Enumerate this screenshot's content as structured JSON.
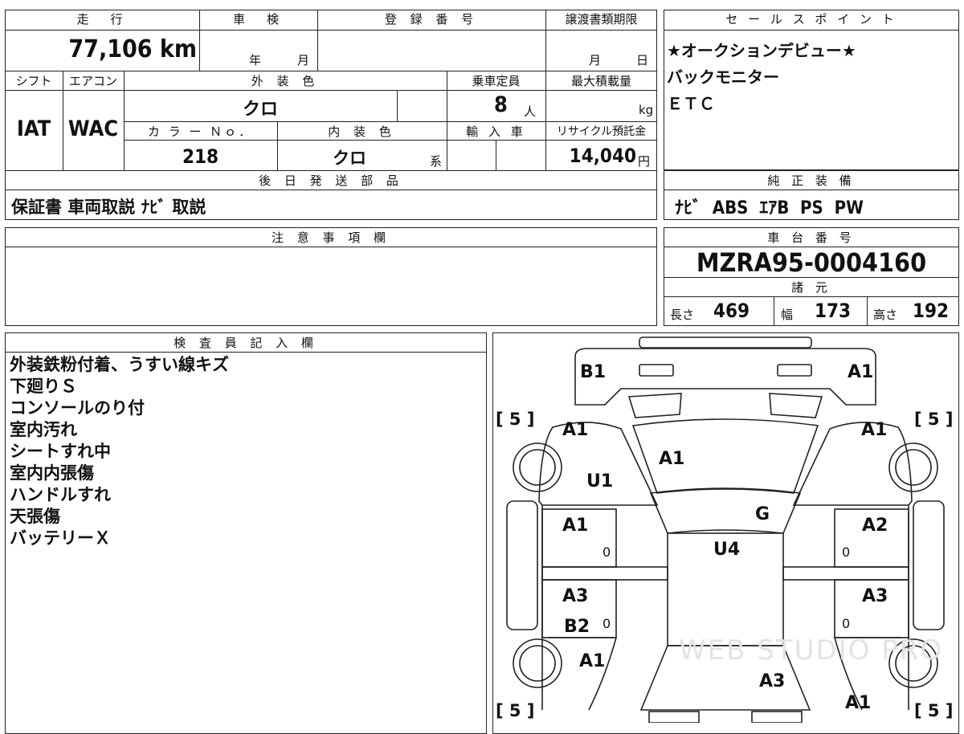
{
  "top_table": {
    "mileage_header": "走　行",
    "mileage_value": "77,106 km",
    "inspection_header": "車　検",
    "inspection_year_unit": "年",
    "inspection_month_unit": "月",
    "registration_header": "登 録 番 号",
    "transfer_deadline_header": "譲渡書類期限",
    "transfer_month_unit": "月",
    "transfer_day_unit": "日",
    "shift_header": "シフト",
    "ac_header": "エアコン",
    "exterior_color_header": "外 装 色",
    "capacity_header": "乗車定員",
    "max_load_header": "最大積載量",
    "shift_value": "IAT",
    "ac_value": "WAC",
    "exterior_color_value": "クロ",
    "capacity_value": "8",
    "capacity_unit": "人",
    "max_load_unit": "kg",
    "color_no_header": "カ ラ ー Ｎｏ．",
    "interior_color_header": "内 装 色",
    "import_header": "輸 入 車",
    "recycle_header": "リサイクル預託金",
    "color_no_value": "218",
    "interior_color_value": "クロ",
    "interior_color_suffix": "系",
    "recycle_value": "14,040",
    "recycle_unit": "円",
    "later_parts_header": "後 日 発 送 部 品",
    "later_parts_value": "保証書 車両取説 ﾅﾋﾞ 取説"
  },
  "sales_points": {
    "header": "セ ー ル ス ポ イ ン ト",
    "lines": [
      "★オークションデビュー★",
      "バックモニター",
      "ＥＴＣ"
    ]
  },
  "genuine_equipment": {
    "header": "純 正 装 備",
    "value": "ﾅﾋﾞ  ABS  ｴｱB  PS  PW"
  },
  "caution": {
    "header": "注 意 事 項 欄"
  },
  "chassis": {
    "header": "車 台 番 号",
    "value": "MZRA95-0004160",
    "specs_header": "諸 元",
    "length_label": "長さ",
    "length_value": "469",
    "width_label": "幅",
    "width_value": "173",
    "height_label": "高さ",
    "height_value": "192"
  },
  "inspector": {
    "header": "検 査 員 記 入 欄",
    "lines": [
      "外装鉄粉付着、うすい線キズ",
      "下廻りＳ",
      "コンソールのり付",
      "室内汚れ",
      "シートすれ中",
      "室内内張傷",
      "ハンドルすれ",
      "天張傷",
      "バッテリーＸ"
    ]
  },
  "diagram": {
    "tire_fl": "[ 5 ]",
    "tire_fr": "[ 5 ]",
    "tire_rl": "[ 5 ]",
    "tire_rr": "[ 5 ]",
    "codes": {
      "front_bumper_left": "B1",
      "front_bumper_right": "A1",
      "front_fender_left": "A1",
      "front_fender_right": "A1",
      "hood": "A1",
      "pillar_left": "U1",
      "windshield": "G",
      "front_door_left": "A1",
      "front_door_right": "A2",
      "roof": "U4",
      "rear_door_left": "A3",
      "rear_door_right": "A3",
      "rear_door_left_2": "B2",
      "rear_fender_left": "A1",
      "rear_glass": "A3",
      "rear_quarter_right": "A1"
    },
    "zero_marks": [
      "0",
      "0",
      "0",
      "0"
    ],
    "watermark": "WEB STUDIO PRO"
  }
}
